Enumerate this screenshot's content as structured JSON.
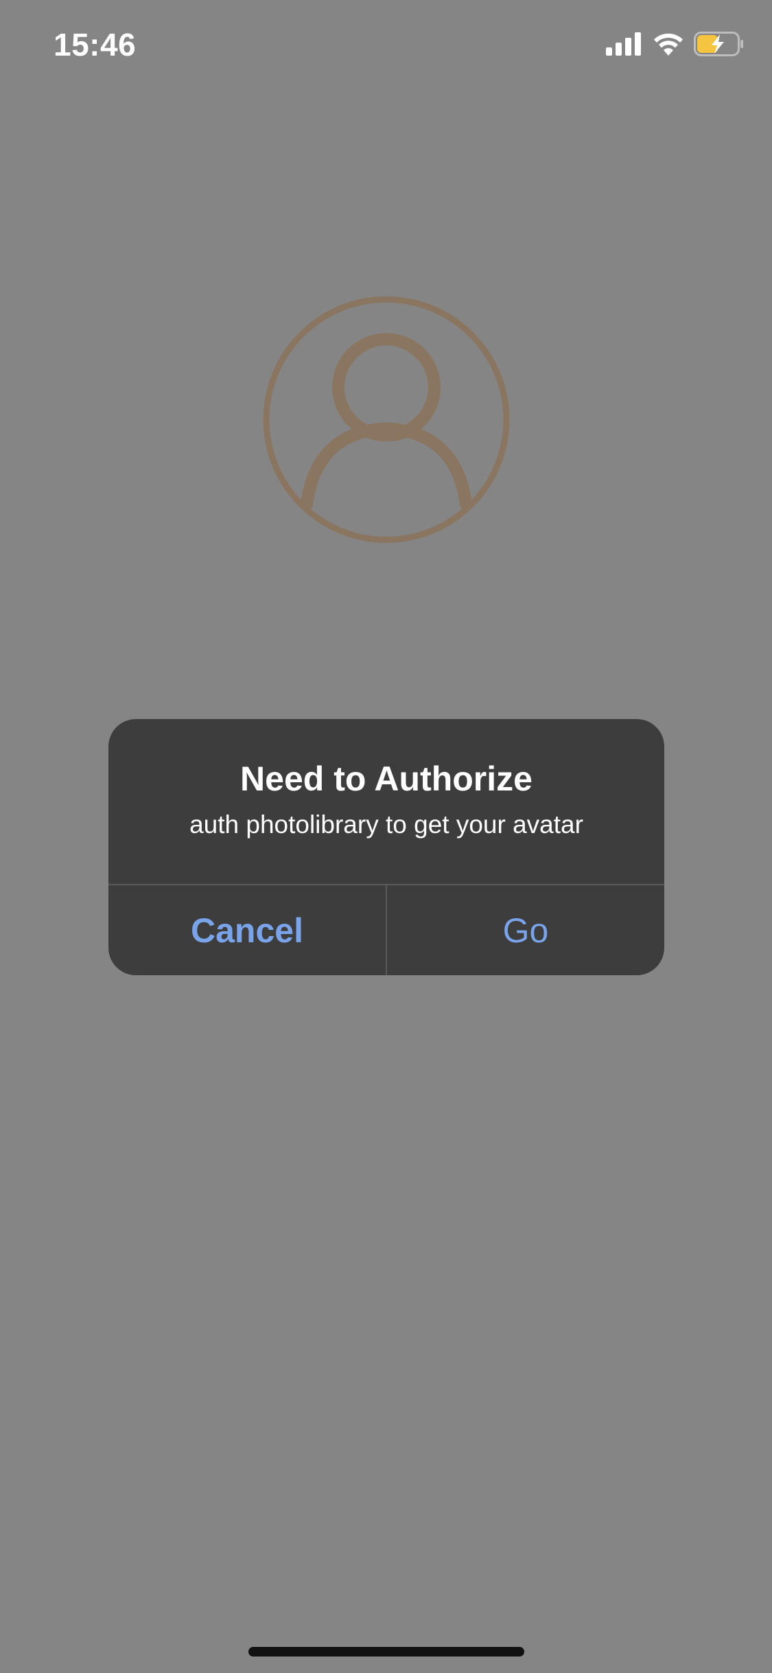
{
  "status_bar": {
    "time": "15:46",
    "signal_icon": "cellular-signal-icon",
    "wifi_icon": "wifi-icon",
    "battery_icon": "battery-charging-icon",
    "battery_color": "#f5c542"
  },
  "avatar": {
    "icon": "user-avatar-placeholder-icon",
    "color": "#8a7560"
  },
  "alert": {
    "title": "Need to Authorize",
    "message": "auth photolibrary to get your avatar",
    "cancel_label": "Cancel",
    "go_label": "Go",
    "button_color": "#7aa4ea"
  }
}
